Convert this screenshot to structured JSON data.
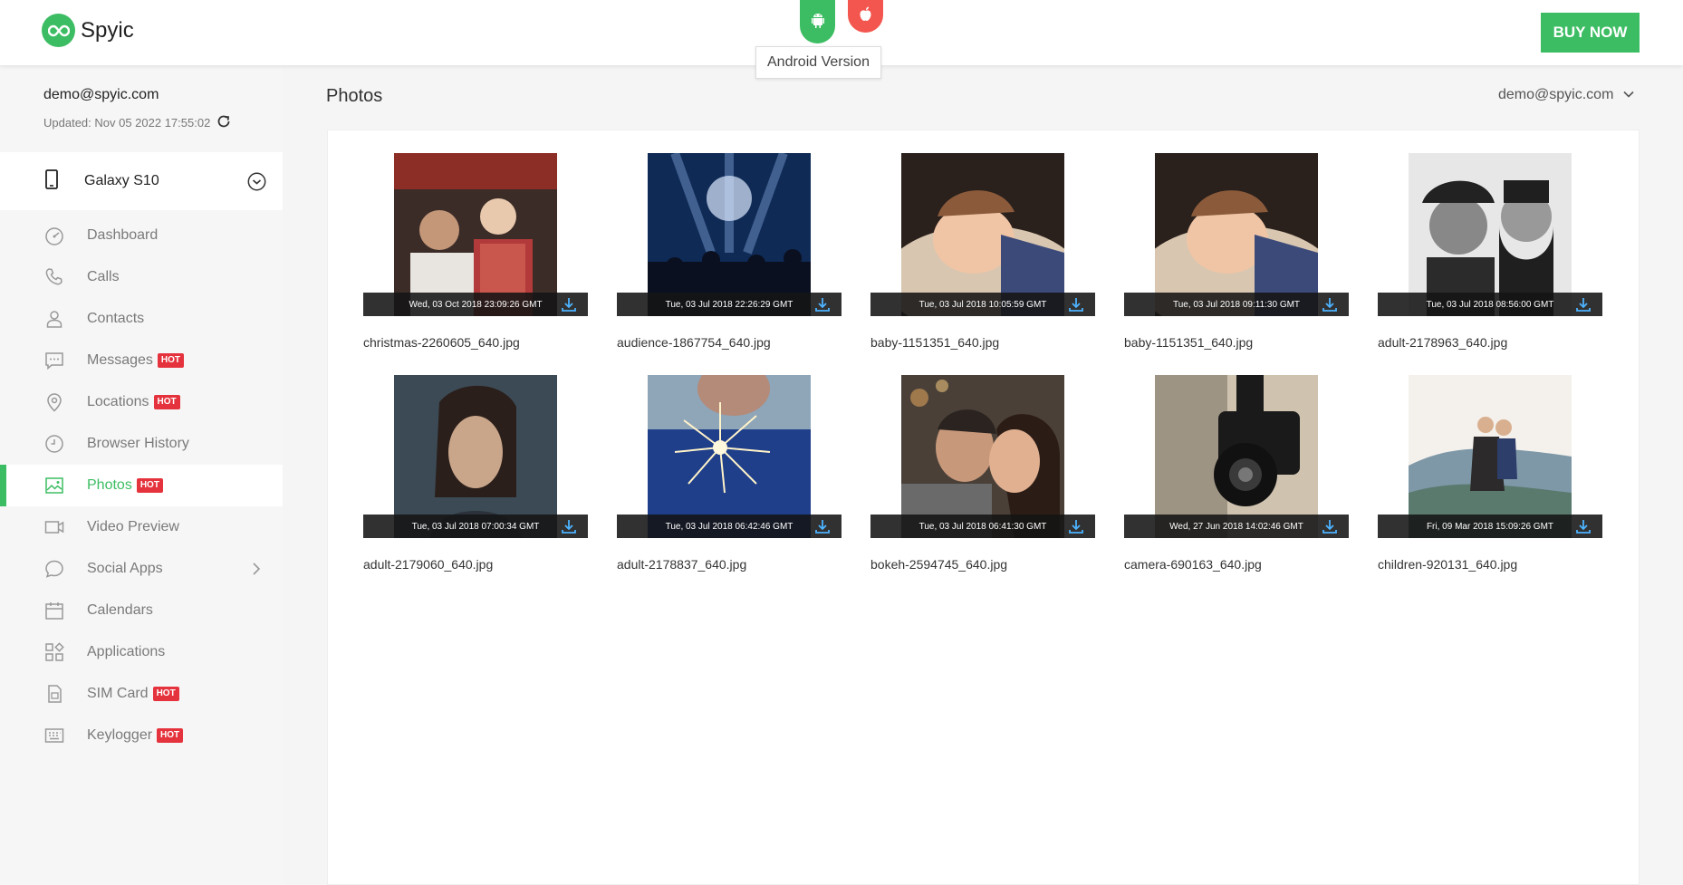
{
  "header": {
    "brand": "Spyic",
    "tooltip": "Android Version",
    "buy_label": "BUY NOW",
    "colors": {
      "brand_green": "#3dbd63",
      "ios_red": "#f2564e",
      "hot_red": "#e5333d"
    }
  },
  "sidebar": {
    "email": "demo@spyic.com",
    "updated": "Updated: Nov 05 2022 17:55:02",
    "device": "Galaxy S10",
    "items": [
      {
        "label": "Dashboard",
        "icon": "dashboard-icon"
      },
      {
        "label": "Calls",
        "icon": "phone-icon"
      },
      {
        "label": "Contacts",
        "icon": "contacts-icon"
      },
      {
        "label": "Messages",
        "icon": "message-icon",
        "badge": "HOT"
      },
      {
        "label": "Locations",
        "icon": "location-icon",
        "badge": "HOT"
      },
      {
        "label": "Browser History",
        "icon": "history-icon"
      },
      {
        "label": "Photos",
        "icon": "photos-icon",
        "badge": "HOT",
        "active": true
      },
      {
        "label": "Video Preview",
        "icon": "video-icon"
      },
      {
        "label": "Social Apps",
        "icon": "chat-icon",
        "chevron": true
      },
      {
        "label": "Calendars",
        "icon": "calendar-icon"
      },
      {
        "label": "Applications",
        "icon": "apps-icon"
      },
      {
        "label": "SIM Card",
        "icon": "sim-icon",
        "badge": "HOT"
      },
      {
        "label": "Keylogger",
        "icon": "keyboard-icon",
        "badge": "HOT"
      }
    ]
  },
  "main": {
    "title": "Photos",
    "user": "demo@spyic.com",
    "photos": [
      {
        "date": "Wed, 03 Oct 2018 23:09:26 GMT",
        "file": "christmas-2260605_640.jpg"
      },
      {
        "date": "Tue, 03 Jul 2018 22:26:29 GMT",
        "file": "audience-1867754_640.jpg"
      },
      {
        "date": "Tue, 03 Jul 2018 10:05:59 GMT",
        "file": "baby-1151351_640.jpg"
      },
      {
        "date": "Tue, 03 Jul 2018 09:11:30 GMT",
        "file": "baby-1151351_640.jpg"
      },
      {
        "date": "Tue, 03 Jul 2018 08:56:00 GMT",
        "file": "adult-2178963_640.jpg"
      },
      {
        "date": "Tue, 03 Jul 2018 07:00:34 GMT",
        "file": "adult-2179060_640.jpg"
      },
      {
        "date": "Tue, 03 Jul 2018 06:42:46 GMT",
        "file": "adult-2178837_640.jpg"
      },
      {
        "date": "Tue, 03 Jul 2018 06:41:30 GMT",
        "file": "bokeh-2594745_640.jpg"
      },
      {
        "date": "Wed, 27 Jun 2018 14:02:46 GMT",
        "file": "camera-690163_640.jpg"
      },
      {
        "date": "Fri, 09 Mar 2018 15:09:26 GMT",
        "file": "children-920131_640.jpg"
      }
    ]
  }
}
